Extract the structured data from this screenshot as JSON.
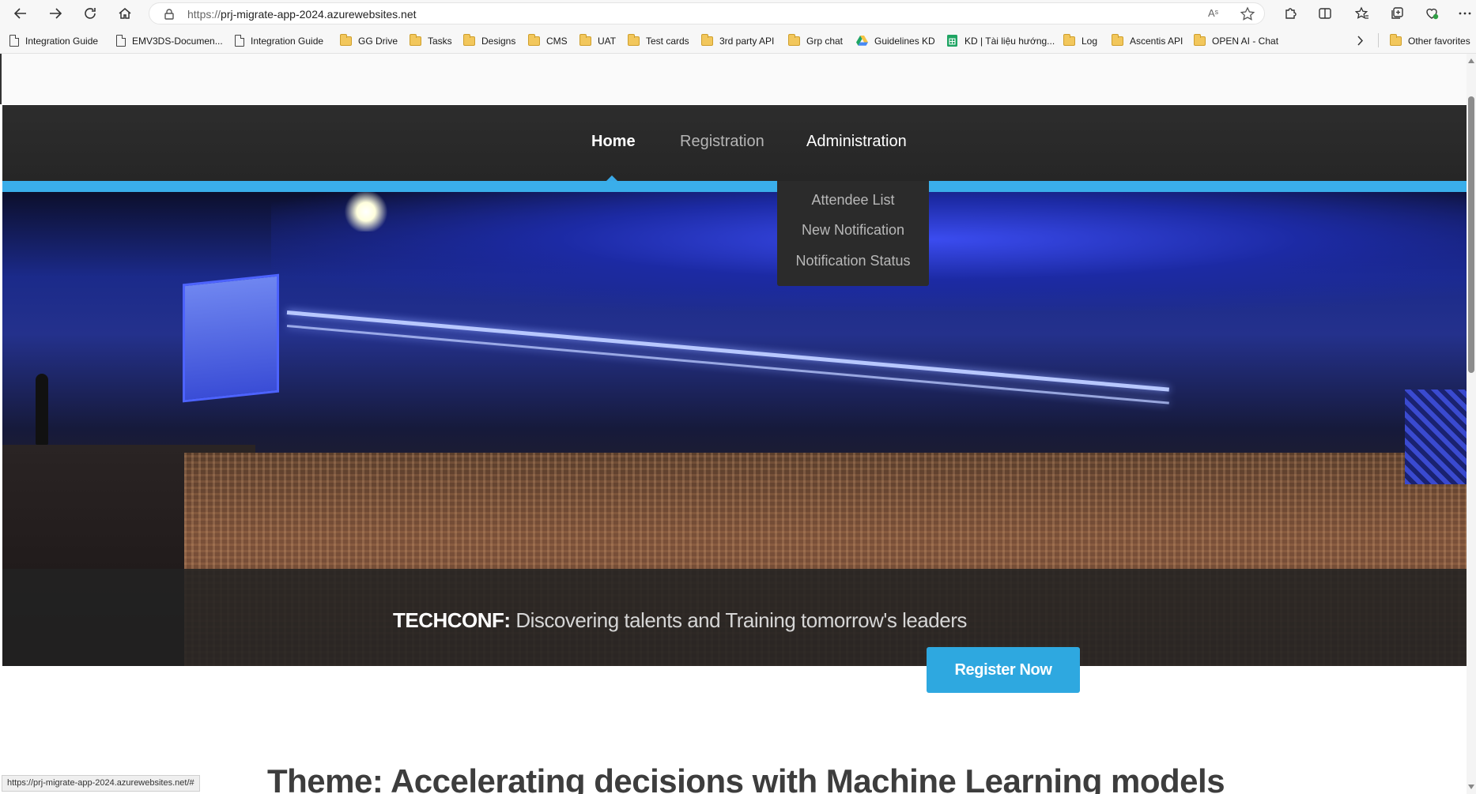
{
  "browser": {
    "url_scheme": "https://",
    "url_host": "prj-migrate-app-2024.azurewebsites.net",
    "read_aloud_label": "Aˢ",
    "bookmarks": [
      {
        "label": "Integration Guide",
        "icon": "page-icon"
      },
      {
        "label": "EMV3DS-Documen...",
        "icon": "page-icon"
      },
      {
        "label": "Integration Guide",
        "icon": "page-icon"
      },
      {
        "label": "GG Drive",
        "icon": "folder-icon"
      },
      {
        "label": "Tasks",
        "icon": "folder-icon"
      },
      {
        "label": "Designs",
        "icon": "folder-icon"
      },
      {
        "label": "CMS",
        "icon": "folder-icon"
      },
      {
        "label": "UAT",
        "icon": "folder-icon"
      },
      {
        "label": "Test cards",
        "icon": "folder-icon"
      },
      {
        "label": "3rd party API",
        "icon": "folder-icon"
      },
      {
        "label": "Grp chat",
        "icon": "folder-icon"
      },
      {
        "label": "Guidelines KD",
        "icon": "google-drive-icon"
      },
      {
        "label": "KD | Tài liệu hướng...",
        "icon": "google-sheets-icon"
      },
      {
        "label": "Log",
        "icon": "folder-icon"
      },
      {
        "label": "Ascentis API",
        "icon": "folder-icon"
      },
      {
        "label": "OPEN AI - Chat",
        "icon": "folder-icon"
      }
    ],
    "other_favorites": "Other favorites",
    "status_url": "https://prj-migrate-app-2024.azurewebsites.net/#"
  },
  "nav": {
    "items": [
      {
        "label": "Home",
        "active": true
      },
      {
        "label": "Registration",
        "active": false
      },
      {
        "label": "Administration",
        "active": false
      }
    ],
    "admin_dropdown": [
      "Attendee List",
      "New Notification",
      "Notification Status"
    ]
  },
  "hero": {
    "brand": "TECHCONF:",
    "tagline": "Discovering talents and Training tomorrow's leaders",
    "cta": "Register Now"
  },
  "theme": {
    "title": "Theme: Accelerating decisions with Machine Learning models"
  },
  "colors": {
    "accent": "#3aaeea",
    "cta": "#2ea8e0",
    "nav_bg": "#2b2b2b"
  }
}
